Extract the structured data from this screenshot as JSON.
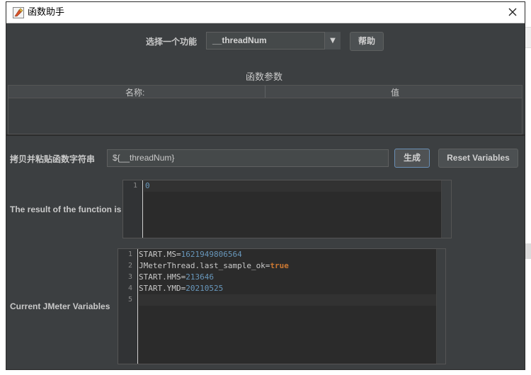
{
  "window": {
    "title": "函数助手"
  },
  "function_select": {
    "label": "选择一个功能",
    "value": "__threadNum",
    "help_button": "帮助"
  },
  "params": {
    "title": "函数参数",
    "columns": [
      "名称:",
      "值"
    ],
    "rows": []
  },
  "function_string": {
    "label": "拷贝并粘贴函数字符串",
    "value": "${__threadNum}",
    "generate_button": "生成",
    "reset_button": "Reset Variables"
  },
  "result": {
    "label": "The result of the function is",
    "lines": [
      {
        "num": "1",
        "text": "0"
      }
    ]
  },
  "variables": {
    "label": "Current JMeter Variables",
    "lines": [
      {
        "num": "1",
        "key": "START.MS=",
        "value": "1621949806564"
      },
      {
        "num": "2",
        "key": "JMeterThread.last_sample_ok=",
        "value": "true"
      },
      {
        "num": "3",
        "key": "START.HMS=",
        "value": "213646"
      },
      {
        "num": "4",
        "key": "START.YMD=",
        "value": "20210525"
      },
      {
        "num": "5",
        "key": "",
        "value": ""
      }
    ]
  },
  "colors": {
    "background": "#3c3f41",
    "editor_background": "#2b2b2b",
    "number_value": "#6897bb",
    "keyword": "#cc7832",
    "focus_border": "#6a8fb5"
  }
}
